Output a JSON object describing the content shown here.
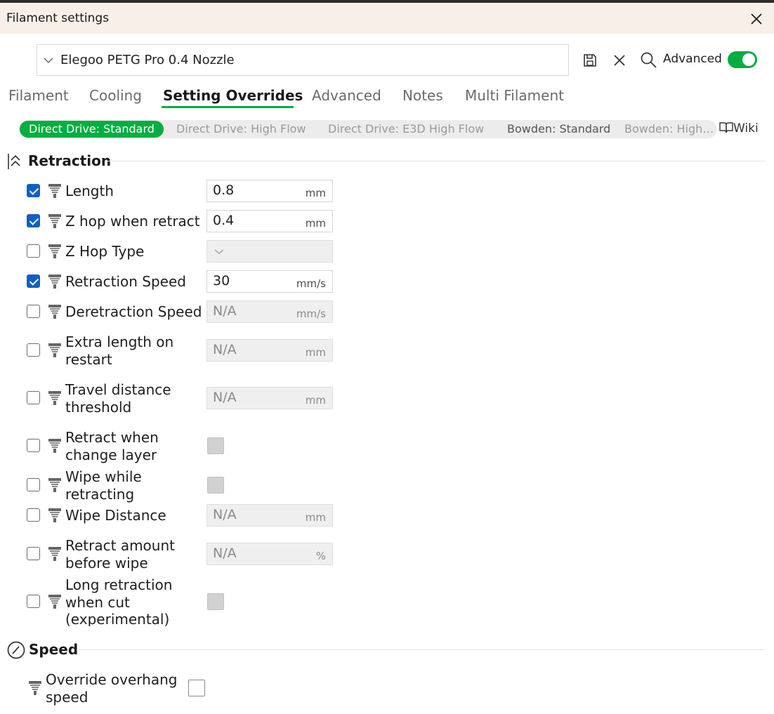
{
  "window": {
    "title": "Filament settings"
  },
  "preset": {
    "name": "Elegoo PETG Pro 0.4 Nozzle"
  },
  "toolbar": {
    "advanced_label": "Advanced",
    "advanced_on": true,
    "accent": "#00ae42"
  },
  "tabs": [
    {
      "label": "Filament"
    },
    {
      "label": "Cooling"
    },
    {
      "label": "Setting Overrides",
      "active": true
    },
    {
      "label": "Advanced"
    },
    {
      "label": "Notes"
    },
    {
      "label": "Multi Filament"
    }
  ],
  "variants": [
    {
      "label": "Direct Drive: Standard",
      "active": true
    },
    {
      "label": "Direct Drive: High Flow"
    },
    {
      "label": "Direct Drive: E3D High Flow"
    },
    {
      "label": "Bowden: Standard"
    },
    {
      "label": "Bowden: High…"
    }
  ],
  "wiki_label": "Wiki",
  "retraction": {
    "title": "Retraction",
    "rows": [
      {
        "checked": true,
        "label": "Length",
        "value": "0.8",
        "unit": "mm"
      },
      {
        "checked": true,
        "label": "Z hop when retract",
        "value": "0.4",
        "unit": "mm"
      },
      {
        "checked": false,
        "label": "Z Hop Type",
        "value": ""
      },
      {
        "checked": true,
        "label": "Retraction Speed",
        "value": "30",
        "unit": "mm/s"
      },
      {
        "checked": false,
        "label": "Deretraction Speed",
        "value": "N/A",
        "unit": "mm/s"
      },
      {
        "checked": false,
        "label_1": "Extra length on",
        "label_2": "restart",
        "value": "N/A",
        "unit": "mm"
      },
      {
        "checked": false,
        "label_1": "Travel distance",
        "label_2": "threshold",
        "value": "N/A",
        "unit": "mm"
      },
      {
        "checked": false,
        "label_1": "Retract when",
        "label_2": "change layer",
        "value": false
      },
      {
        "checked": false,
        "label_1": "Wipe while",
        "label_2": "retracting",
        "value": false
      },
      {
        "checked": false,
        "label": "Wipe Distance",
        "value": "N/A",
        "unit": "mm"
      },
      {
        "checked": false,
        "label_1": "Retract amount",
        "label_2": "before wipe",
        "value": "N/A",
        "unit": "%"
      },
      {
        "checked": false,
        "label_1": "Long retraction",
        "label_2": "when cut",
        "label_3": "(experimental)",
        "value": false
      }
    ]
  },
  "speed": {
    "title": "Speed",
    "rows": [
      {
        "label_1": "Override overhang",
        "label_2": "speed",
        "value": false
      }
    ]
  }
}
